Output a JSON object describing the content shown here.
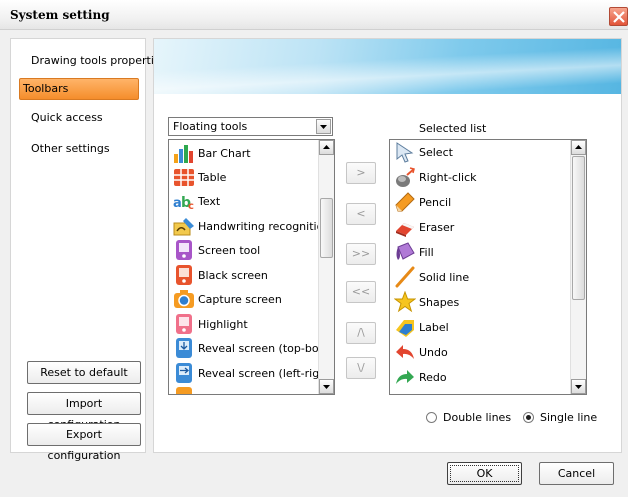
{
  "window": {
    "title": "System setting",
    "close_icon": "close-icon"
  },
  "nav": {
    "items": [
      {
        "label": "Drawing tools properties",
        "selected": false
      },
      {
        "label": "Toolbars",
        "selected": true
      },
      {
        "label": "Quick access",
        "selected": false
      },
      {
        "label": "Other settings",
        "selected": false
      }
    ],
    "selected_color": "#f58d2b"
  },
  "left_buttons": {
    "reset": "Reset to default",
    "import": "Import configuration",
    "export": "Export configuration"
  },
  "dropdown": {
    "value": "Floating tools"
  },
  "available_list": {
    "items": [
      {
        "label": "Bar Chart",
        "icon": "bar-chart-icon"
      },
      {
        "label": "Table",
        "icon": "table-icon"
      },
      {
        "label": "Text",
        "icon": "text-icon"
      },
      {
        "label": "Handwriting recognition",
        "icon": "handwriting-icon"
      },
      {
        "label": "Screen tool",
        "icon": "screen-tool-icon"
      },
      {
        "label": "Black screen",
        "icon": "black-screen-icon"
      },
      {
        "label": "Capture screen",
        "icon": "camera-icon"
      },
      {
        "label": "Highlight",
        "icon": "highlight-icon"
      },
      {
        "label": "Reveal screen (top-bottom",
        "icon": "reveal-top-bottom-icon"
      },
      {
        "label": "Reveal screen (left-right)",
        "icon": "reveal-left-right-icon"
      }
    ]
  },
  "transfer_buttons": {
    "add": ">",
    "remove": "<",
    "add_all": ">>",
    "remove_all": "<<",
    "move_up": "/\\",
    "move_down": "\\/"
  },
  "selected_list": {
    "title": "Selected list",
    "items": [
      {
        "label": "Select",
        "icon": "select-cursor-icon"
      },
      {
        "label": "Right-click",
        "icon": "right-click-icon"
      },
      {
        "label": "Pencil",
        "icon": "pencil-icon"
      },
      {
        "label": "Eraser",
        "icon": "eraser-icon"
      },
      {
        "label": "Fill",
        "icon": "fill-icon"
      },
      {
        "label": "Solid line",
        "icon": "solid-line-icon"
      },
      {
        "label": "Shapes",
        "icon": "shapes-icon"
      },
      {
        "label": "Label",
        "icon": "label-icon"
      },
      {
        "label": "Undo",
        "icon": "undo-icon"
      },
      {
        "label": "Redo",
        "icon": "redo-icon"
      }
    ]
  },
  "layout_options": {
    "double_lines": "Double lines",
    "single_line": "Single line",
    "selected": "single_line"
  },
  "footer": {
    "ok": "OK",
    "cancel": "Cancel"
  }
}
